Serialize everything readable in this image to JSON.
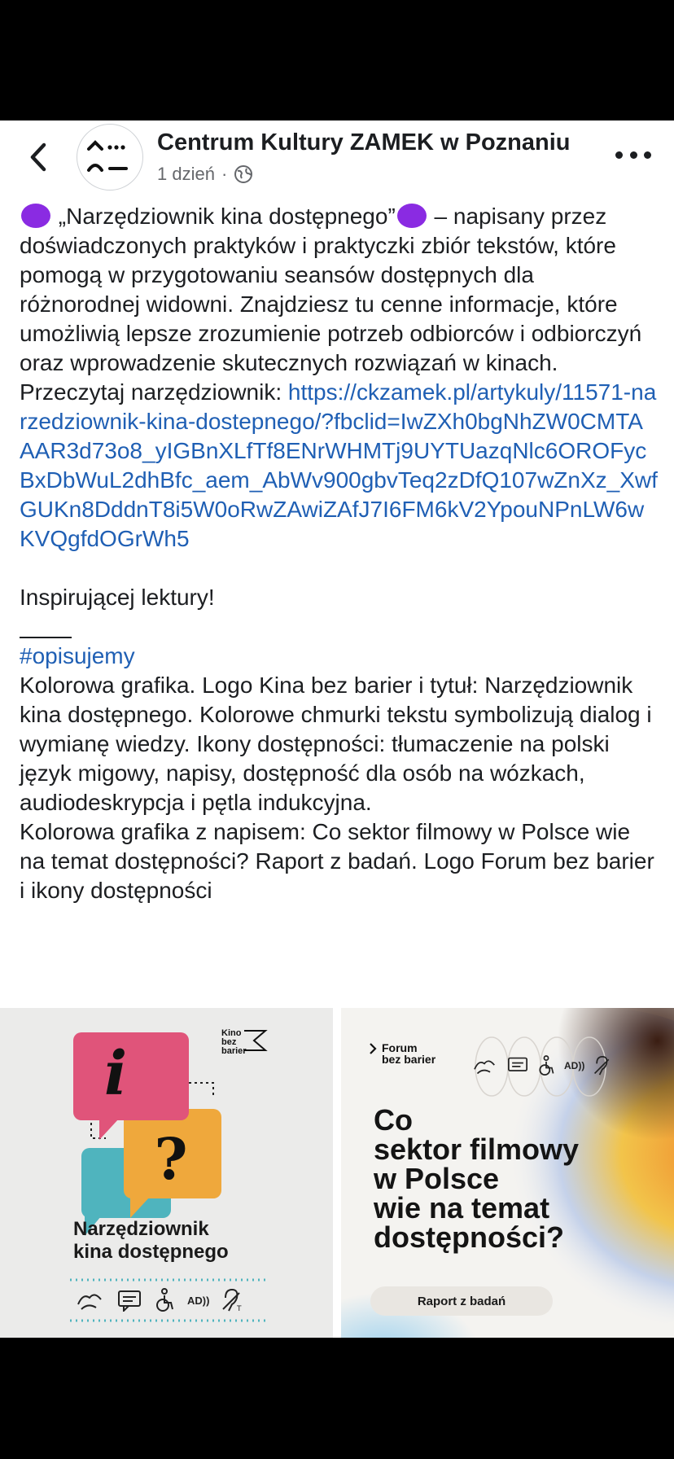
{
  "header": {
    "page_name": "Centrum Kultury ZAMEK w Poznaniu",
    "time": "1 dzień",
    "separator": "·"
  },
  "post": {
    "intro_quote": "„Narzędziownik kina dostępnego”",
    "intro_rest": " – napisany przez doświadczonych praktyków i praktyczki zbiór tekstów, które pomogą w przygotowaniu seansów dostępnych dla różnorodnej widowni. Znajdziesz tu cenne informacje, które umożliwią lepsze zrozumienie potrzeb odbiorców i odbiorczyń oraz wprowadzenie skutecznych rozwiązań w kinach. Przeczytaj narzędziownik: ",
    "link": "https://ckzamek.pl/artykuly/11571-narzedziownik-kina-dostepnego/?fbclid=IwZXh0bgNhZW0CMTAAAR3d73o8_yIGBnXLfTf8ENrWHMTj9UYTUazqNlc6OROFycBxDbWuL2dhBfc_aem_AbWv900gbvTeq2zDfQ107wZnXz_XwfGUKn8DddnT8i5W0oRwZAwiZAfJ7I6FM6kV2YpouNPnLW6wKVQgfdOGrWh5",
    "closing": "Inspirującej lektury!",
    "hashtag": "#opisujemy",
    "description_1": "Kolorowa grafika. Logo Kina bez barier i tytuł: Narzędziownik kina dostępnego. Kolorowe chmurki tekstu symbolizują dialog i wymianę wiedzy. Ikony dostępności: tłumaczenie na polski język migowy, napisy, dostępność dla osób na wózkach, audiodeskrypcja i pętla indukcyjna.",
    "description_2": "Kolorowa grafika z napisem: Co sektor filmowy w Polsce wie na temat dostępności? Raport z badań. Logo Forum bez barier i ikony dostępności"
  },
  "image_left": {
    "logo_line1": "Kino",
    "logo_line2": "bez",
    "logo_line3": "barier",
    "title_line1": "Narzędziownik",
    "title_line2": "kina dostępnego",
    "ad_label": "AD))"
  },
  "image_right": {
    "logo_line1": "Forum",
    "logo_line2": "bez barier",
    "title_line1": "Co",
    "title_line2": "sektor filmowy",
    "title_line3": "w Polsce",
    "title_line4": "wie na temat",
    "title_line5": "dostępności?",
    "report": "Raport z badań",
    "ad_label": "AD))"
  },
  "colors": {
    "link": "#1f5fb4",
    "emoji_purple": "#8a2be2",
    "bubble_pink": "#e0547a",
    "bubble_orange": "#efa83c",
    "bubble_teal": "#4fb4be"
  }
}
